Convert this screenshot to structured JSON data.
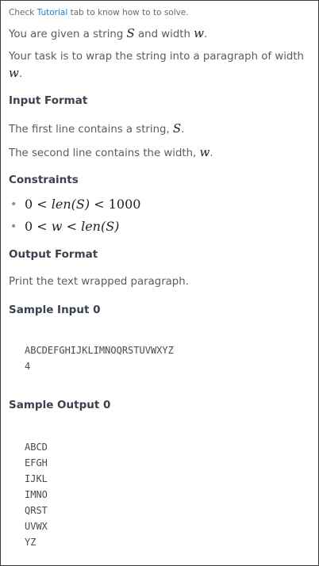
{
  "hint": {
    "prefix": "Check ",
    "link": "Tutorial",
    "suffix": " tab to know how to to solve."
  },
  "intro": {
    "line1_a": "You are given a string ",
    "line1_var_s": "S",
    "line1_b": " and width ",
    "line1_var_w": "w",
    "line1_c": ".",
    "line2_a": "Your task is to wrap the string into a paragraph of width ",
    "line2_var_w": "w",
    "line2_b": "."
  },
  "input_format": {
    "heading": "Input Format",
    "line1_a": "The first line contains a string, ",
    "line1_var": "S",
    "line1_b": ".",
    "line2_a": "The second line contains the width, ",
    "line2_var": "w",
    "line2_b": "."
  },
  "constraints": {
    "heading": "Constraints",
    "items": [
      {
        "lhs": "0",
        "op1": "<",
        "mid": "len(S)",
        "op2": "<",
        "rhs": "1000"
      },
      {
        "lhs": "0",
        "op1": "<",
        "mid": "w",
        "op2": "<",
        "rhs": "len(S)"
      }
    ]
  },
  "output_format": {
    "heading": "Output Format",
    "text": "Print the text wrapped paragraph."
  },
  "sample_input": {
    "heading": "Sample Input 0",
    "lines": [
      "ABCDEFGHIJKLIMNOQRSTUVWXYZ",
      "4"
    ]
  },
  "sample_output": {
    "heading": "Sample Output 0",
    "lines": [
      "ABCD",
      "EFGH",
      "IJKL",
      "IMNO",
      "QRST",
      "UVWX",
      "YZ"
    ]
  }
}
